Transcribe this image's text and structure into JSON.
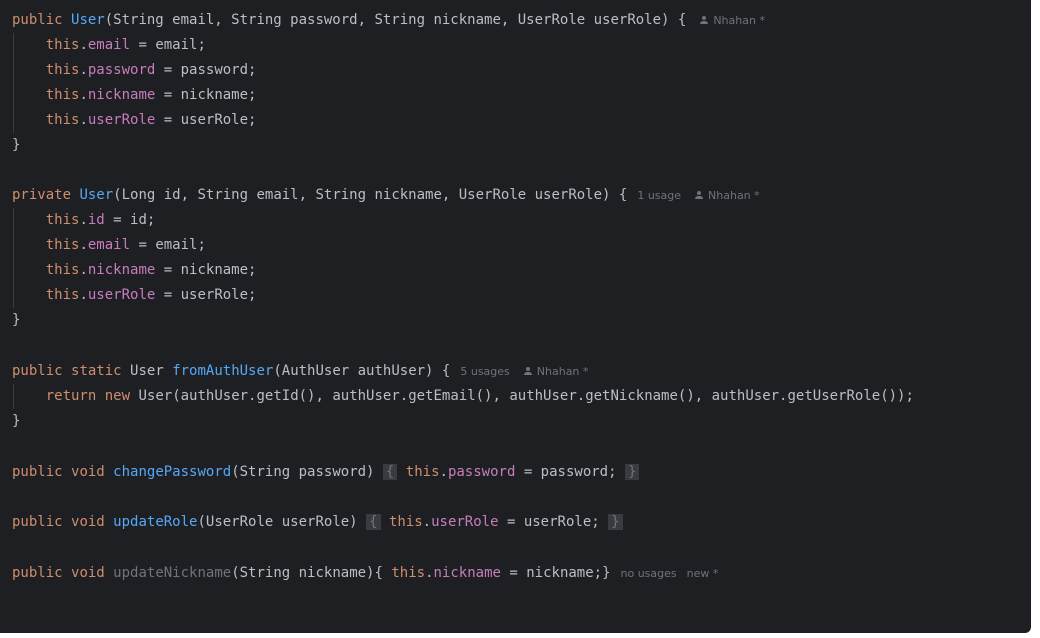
{
  "editor": {
    "author": "Nhahan *",
    "ctor1": {
      "signature": "(String email, String password, String nickname, UserRole userRole) {",
      "lines": [
        {
          "field": "email",
          "rhs": " = email;"
        },
        {
          "field": "password",
          "rhs": " = password;"
        },
        {
          "field": "nickname",
          "rhs": " = nickname;"
        },
        {
          "field": "userRole",
          "rhs": " = userRole;"
        }
      ]
    },
    "ctor2": {
      "signature": "(Long id, String email, String nickname, UserRole userRole) {",
      "usages": "1 usage",
      "lines": [
        {
          "field": "id",
          "rhs": " = id;"
        },
        {
          "field": "email",
          "rhs": " = email;"
        },
        {
          "field": "nickname",
          "rhs": " = nickname;"
        },
        {
          "field": "userRole",
          "rhs": " = userRole;"
        }
      ]
    },
    "fromAuthUser": {
      "name": "fromAuthUser",
      "signature": "(AuthUser authUser) {",
      "usages": "5 usages",
      "body": "(authUser.getId(), authUser.getEmail(), authUser.getNickname(), authUser.getUserRole());"
    },
    "changePassword": {
      "name": "changePassword",
      "params": "(String password)",
      "field": "password",
      "rhs": " = password;"
    },
    "updateRole": {
      "name": "updateRole",
      "params": "(UserRole userRole)",
      "field": "userRole",
      "rhs": " = userRole;"
    },
    "updateNickname": {
      "name": "updateNickname",
      "params": "(String nickname){ ",
      "field": "nickname",
      "rhs": " = nickname;}",
      "usages": "no usages",
      "status": "new *"
    },
    "keywords": {
      "public": "public",
      "private": "private",
      "static": "static",
      "void": "void",
      "this": "this",
      "return": "return",
      "new": "new",
      "class_name": "User"
    },
    "colors": {
      "background": "#1e1f22",
      "keyword": "#cf8e6d",
      "function": "#56a8f5",
      "field": "#c77dbb",
      "text": "#bcbec4",
      "hint": "#6f737a"
    }
  }
}
